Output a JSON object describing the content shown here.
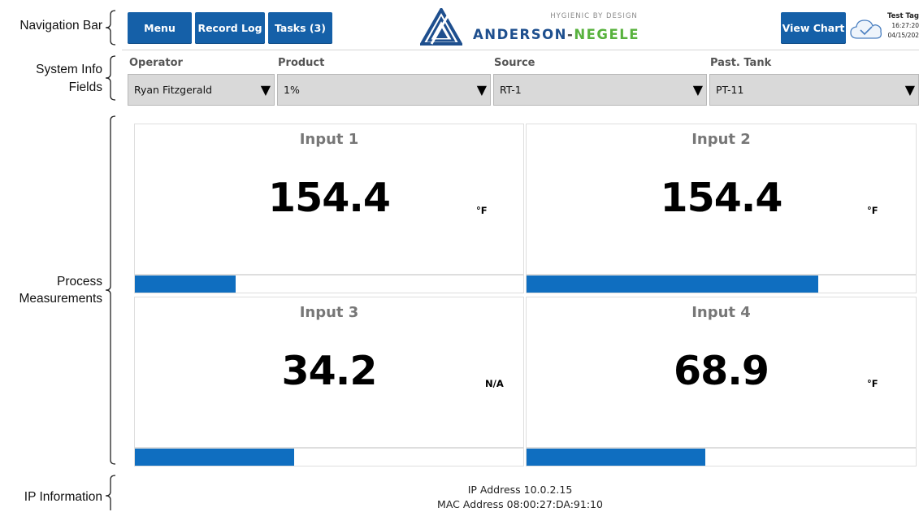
{
  "annotations": {
    "navigation_bar": "Navigation Bar",
    "system_info_line1": "System Info",
    "system_info_line2": "Fields",
    "process_line1": "Process",
    "process_line2": "Measurements",
    "ip_information": "IP Information"
  },
  "nav": {
    "menu_label": "Menu",
    "record_log_label": "Record Log",
    "tasks_label": "Tasks (3)",
    "view_chart_label": "View Chart",
    "brand_tagline": "HYGIENIC BY DESIGN",
    "brand_part1": "ANDERSON",
    "brand_part2": "-",
    "brand_part3": "NEGELE",
    "cloud_icon": "cloud-check-icon",
    "tag_name": "Test Tag",
    "time": "16:27:20",
    "date": "04/15/202"
  },
  "fields": {
    "operator": {
      "label": "Operator",
      "value": "Ryan Fitzgerald"
    },
    "product": {
      "label": "Product",
      "value": "1%"
    },
    "source": {
      "label": "Source",
      "value": "RT-1"
    },
    "past_tank": {
      "label": "Past. Tank",
      "value": "PT-11"
    },
    "dropdown_icon": "triangle-down-icon"
  },
  "inputs": [
    {
      "title": "Input 1",
      "value": "154.4",
      "unit": "°F",
      "level": 0.26
    },
    {
      "title": "Input 2",
      "value": "154.4",
      "unit": "°F",
      "level": 0.75
    },
    {
      "title": "Input 3",
      "value": "34.2",
      "unit": "N/A",
      "level": 0.41
    },
    {
      "title": "Input 4",
      "value": "68.9",
      "unit": "°F",
      "level": 0.46
    }
  ],
  "network": {
    "ip_address": "IP Address 10.0.2.15",
    "mac_address": "MAC Address 08:00:27:DA:91:10"
  },
  "colors": {
    "button_blue": "#1560a8",
    "bar_blue": "#0f6ec0",
    "brand_blue": "#1e4f8e",
    "brand_green": "#58b23d"
  }
}
